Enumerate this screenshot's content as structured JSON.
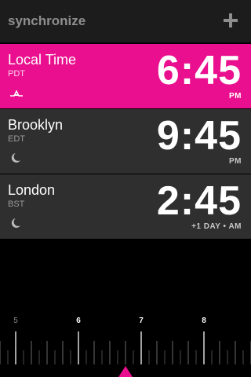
{
  "header": {
    "title": "synchronize",
    "add_icon": "plus-icon"
  },
  "colors": {
    "accent": "#ea0f8e",
    "row_bg": "#2f2f2f",
    "header_bg": "#1c1c1c",
    "background": "#000000"
  },
  "clocks": [
    {
      "city": "Local Time",
      "tz": "PDT",
      "time": "6:45",
      "meridiem": "PM",
      "icon": "sunset-icon",
      "selected": true
    },
    {
      "city": "Brooklyn",
      "tz": "EDT",
      "time": "9:45",
      "meridiem": "PM",
      "icon": "moon-icon",
      "selected": false
    },
    {
      "city": "London",
      "tz": "BST",
      "time": "2:45",
      "meridiem": "+1 DAY • AM",
      "icon": "moon-icon",
      "selected": false
    }
  ],
  "slider": {
    "hour_labels": [
      "5",
      "6",
      "7",
      "8"
    ],
    "highlighted_labels": [
      "6",
      "7",
      "8"
    ],
    "pointer_icon": "triangle-pointer-icon"
  }
}
